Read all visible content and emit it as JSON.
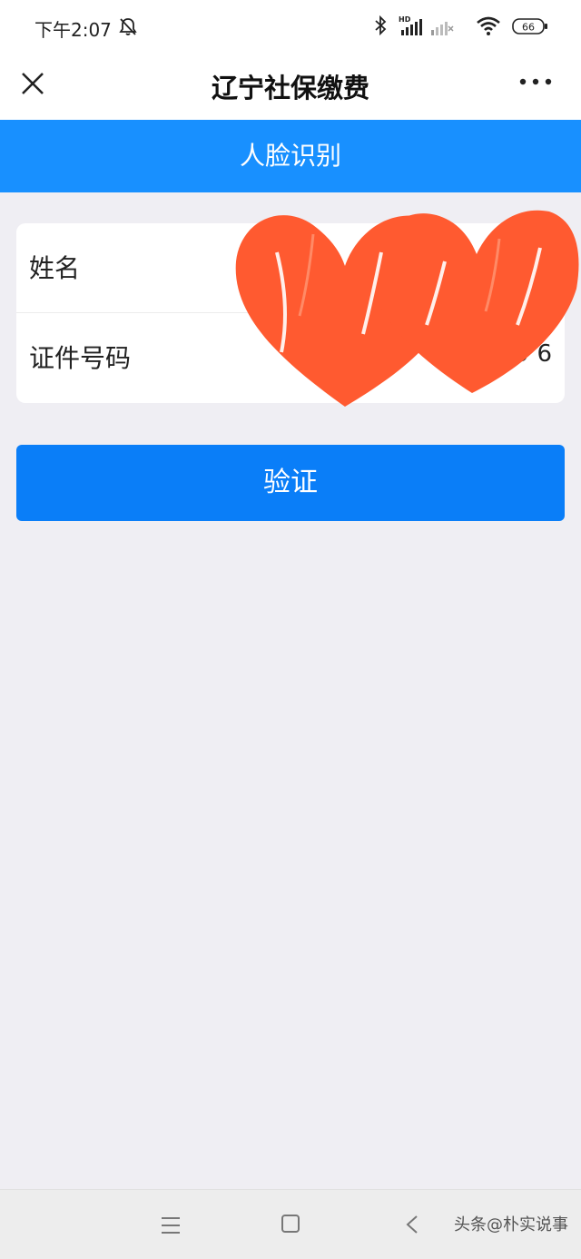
{
  "status_bar": {
    "time": "下午2:07",
    "battery": "66",
    "hd_label": "HD",
    "icons": [
      "bell-muted-icon",
      "bluetooth-icon",
      "signal-icon",
      "signal-weak-icon",
      "wifi-icon",
      "battery-icon"
    ]
  },
  "nav": {
    "title": "辽宁社保缴费",
    "close_icon": "close-icon",
    "more_icon": "more-icon"
  },
  "section": {
    "title": "人脸识别"
  },
  "form": {
    "fields": [
      {
        "label": "姓名",
        "value": ""
      },
      {
        "label": "证件号码",
        "value": "2                 9           6"
      }
    ]
  },
  "actions": {
    "verify_label": "验证"
  },
  "colors": {
    "header_blue": "#1890ff",
    "button_blue": "#0a7ef8",
    "redaction_red": "#ff5a30",
    "background": "#efeef3"
  },
  "bottom_nav": {
    "icons": [
      "menu-icon",
      "home-icon",
      "back-icon"
    ],
    "watermark": "头条@朴实说事"
  }
}
